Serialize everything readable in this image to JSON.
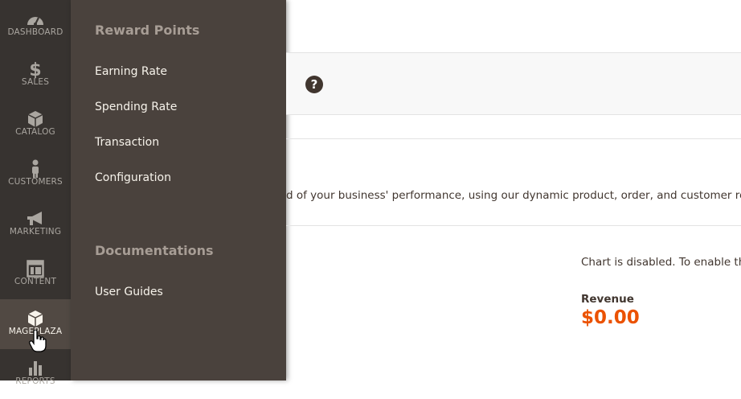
{
  "nav": {
    "items": [
      {
        "label": "DASHBOARD",
        "icon": "dashboard-icon"
      },
      {
        "label": "SALES",
        "icon": "dollar-icon"
      },
      {
        "label": "CATALOG",
        "icon": "box-icon"
      },
      {
        "label": "CUSTOMERS",
        "icon": "person-icon"
      },
      {
        "label": "MARKETING",
        "icon": "megaphone-icon"
      },
      {
        "label": "CONTENT",
        "icon": "layout-icon"
      },
      {
        "label": "MAGEPLAZA",
        "icon": "box-icon"
      },
      {
        "label": "REPORTS",
        "icon": "bar-chart-icon"
      }
    ],
    "active": "MAGEPLAZA"
  },
  "flyout": {
    "section1": {
      "heading": "Reward Points",
      "links": [
        "Earning Rate",
        "Spending Rate",
        "Transaction",
        "Configuration"
      ]
    },
    "section2": {
      "heading": "Documentations",
      "links": [
        "User Guides"
      ]
    }
  },
  "main": {
    "help_icon": "?",
    "description": "d of your business' performance, using our dynamic product, order, and customer repo",
    "chart_message": "Chart is disabled. To enable the",
    "revenue_label": "Revenue",
    "revenue_value": "$0.00"
  },
  "colors": {
    "nav_bg": "#373330",
    "flyout_bg": "#4a423d",
    "accent": "#eb5202",
    "text": "#41362f"
  }
}
